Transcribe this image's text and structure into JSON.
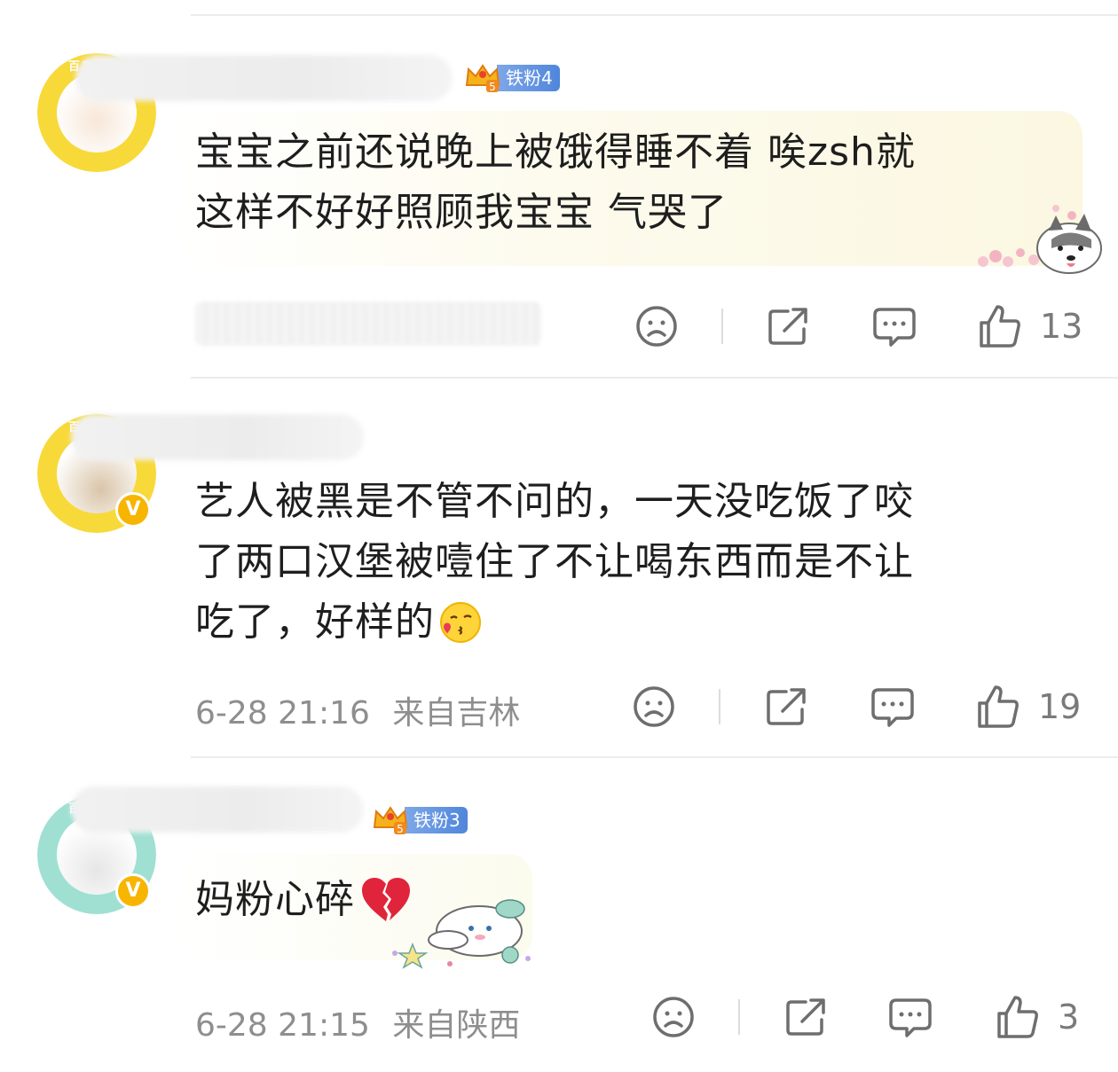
{
  "comments": [
    {
      "fan_badge": "铁粉4",
      "fan_badge_level": "5",
      "content": "宝宝之前还说晚上被饿得睡不着 唉zsh就这样不好好照顾我宝宝 气哭了",
      "content_lines": [
        "宝宝之前还说晚上被饿得睡不着 唉zsh就",
        "这样不好好照顾我宝宝 气哭了"
      ],
      "likes": "13"
    },
    {
      "verified_mark": "V",
      "content": "艺人被黑是不管不问的，一天没吃饭了咬了两口汉堡被噎住了不让喝东西而是不让吃了，好样的",
      "content_lines": [
        "艺人被黑是不管不问的，一天没吃饭了咬",
        "了两口汉堡被噎住了不让喝东西而是不让",
        "吃了，好样的"
      ],
      "emoji": "kiss-face-emoji",
      "time": "6-28 21:16",
      "location": "来自吉林",
      "likes": "19"
    },
    {
      "fan_badge": "铁粉3",
      "fan_badge_level": "5",
      "verified_mark": "V",
      "content": "妈粉心碎",
      "emoji": "broken-heart-emoji",
      "time": "6-28 21:15",
      "location": "来自陕西",
      "likes": "3"
    }
  ],
  "avatar_ring_text": "百字闹田",
  "icons": {
    "dislike": "sad-face-icon",
    "share": "share-icon",
    "reply": "comment-bubble-icon",
    "like": "thumbs-up-icon"
  },
  "colors": {
    "ring_yellow": "#f8d93a",
    "ring_teal": "#9fe0d3",
    "fan_badge_blue": "#5a8ddf",
    "meta_gray": "#8e8e8e",
    "divider": "#ececec"
  }
}
